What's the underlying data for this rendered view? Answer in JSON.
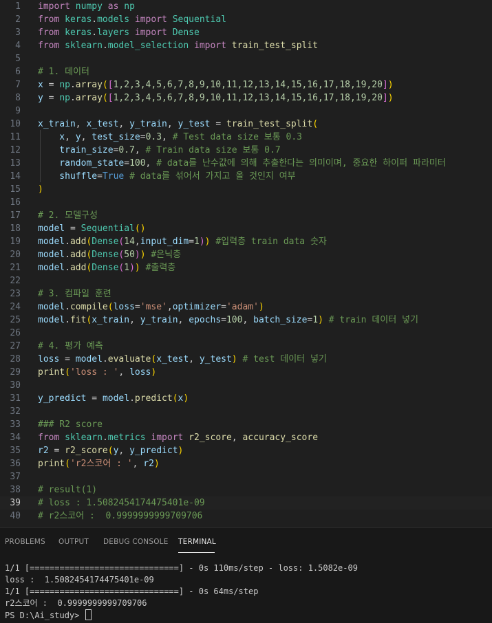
{
  "editor": {
    "lines": [
      {
        "n": "1",
        "tokens": [
          {
            "t": "import",
            "c": "keyword"
          },
          {
            "t": " numpy ",
            "c": "class"
          },
          {
            "t": "as",
            "c": "keyword"
          },
          {
            "t": " np",
            "c": "class"
          }
        ]
      },
      {
        "n": "2",
        "tokens": [
          {
            "t": "from",
            "c": "keyword"
          },
          {
            "t": " keras",
            "c": "class"
          },
          {
            "t": ".",
            "c": "plain"
          },
          {
            "t": "models",
            "c": "class"
          },
          {
            "t": " ",
            "c": "plain"
          },
          {
            "t": "import",
            "c": "keyword"
          },
          {
            "t": " Sequential",
            "c": "class"
          }
        ]
      },
      {
        "n": "3",
        "tokens": [
          {
            "t": "from",
            "c": "keyword"
          },
          {
            "t": " keras",
            "c": "class"
          },
          {
            "t": ".",
            "c": "plain"
          },
          {
            "t": "layers",
            "c": "class"
          },
          {
            "t": " ",
            "c": "plain"
          },
          {
            "t": "import",
            "c": "keyword"
          },
          {
            "t": " Dense",
            "c": "class"
          }
        ]
      },
      {
        "n": "4",
        "tokens": [
          {
            "t": "from",
            "c": "keyword"
          },
          {
            "t": " sklearn",
            "c": "class"
          },
          {
            "t": ".",
            "c": "plain"
          },
          {
            "t": "model_selection",
            "c": "class"
          },
          {
            "t": " ",
            "c": "plain"
          },
          {
            "t": "import",
            "c": "keyword"
          },
          {
            "t": " train_test_split",
            "c": "func"
          }
        ]
      },
      {
        "n": "5",
        "tokens": []
      },
      {
        "n": "6",
        "tokens": [
          {
            "t": "# 1. 데이터",
            "c": "comment"
          }
        ]
      },
      {
        "n": "7",
        "tokens": [
          {
            "t": "x",
            "c": "var"
          },
          {
            "t": " = ",
            "c": "plain"
          },
          {
            "t": "np",
            "c": "class"
          },
          {
            "t": ".",
            "c": "plain"
          },
          {
            "t": "array",
            "c": "func"
          },
          {
            "t": "(",
            "c": "bracket1"
          },
          {
            "t": "[",
            "c": "bracket2"
          },
          {
            "t": "1,2,3,4,5,6,7,8,9,10,11,12,13,14,15,16,17,18,19,20",
            "c": "num"
          },
          {
            "t": "]",
            "c": "bracket2"
          },
          {
            "t": ")",
            "c": "bracket1"
          }
        ]
      },
      {
        "n": "8",
        "tokens": [
          {
            "t": "y",
            "c": "var"
          },
          {
            "t": " = ",
            "c": "plain"
          },
          {
            "t": "np",
            "c": "class"
          },
          {
            "t": ".",
            "c": "plain"
          },
          {
            "t": "array",
            "c": "func"
          },
          {
            "t": "(",
            "c": "bracket1"
          },
          {
            "t": "[",
            "c": "bracket2"
          },
          {
            "t": "1,2,3,4,5,6,7,8,9,10,11,12,13,14,15,16,17,18,19,20",
            "c": "num"
          },
          {
            "t": "]",
            "c": "bracket2"
          },
          {
            "t": ")",
            "c": "bracket1"
          }
        ]
      },
      {
        "n": "9",
        "tokens": []
      },
      {
        "n": "10",
        "tokens": [
          {
            "t": "x_train",
            "c": "var"
          },
          {
            "t": ", ",
            "c": "plain"
          },
          {
            "t": "x_test",
            "c": "var"
          },
          {
            "t": ", ",
            "c": "plain"
          },
          {
            "t": "y_train",
            "c": "var"
          },
          {
            "t": ", ",
            "c": "plain"
          },
          {
            "t": "y_test",
            "c": "var"
          },
          {
            "t": " = ",
            "c": "plain"
          },
          {
            "t": "train_test_split",
            "c": "func"
          },
          {
            "t": "(",
            "c": "bracket1"
          }
        ]
      },
      {
        "n": "11",
        "tokens": [
          {
            "t": "    x",
            "c": "var"
          },
          {
            "t": ", ",
            "c": "plain"
          },
          {
            "t": "y",
            "c": "var"
          },
          {
            "t": ", ",
            "c": "plain"
          },
          {
            "t": "test_size",
            "c": "var"
          },
          {
            "t": "=",
            "c": "plain"
          },
          {
            "t": "0.3",
            "c": "num"
          },
          {
            "t": ", ",
            "c": "plain"
          },
          {
            "t": "# Test data size 보통 0.3",
            "c": "comment"
          }
        ]
      },
      {
        "n": "12",
        "tokens": [
          {
            "t": "    train_size",
            "c": "var"
          },
          {
            "t": "=",
            "c": "plain"
          },
          {
            "t": "0.7",
            "c": "num"
          },
          {
            "t": ", ",
            "c": "plain"
          },
          {
            "t": "# Train data size 보통 0.7",
            "c": "comment"
          }
        ]
      },
      {
        "n": "13",
        "tokens": [
          {
            "t": "    random_state",
            "c": "var"
          },
          {
            "t": "=",
            "c": "plain"
          },
          {
            "t": "100",
            "c": "num"
          },
          {
            "t": ", ",
            "c": "plain"
          },
          {
            "t": "# data를 난수값에 의해 추출한다는 의미이며, 중요한 하이퍼 파라미터",
            "c": "comment"
          }
        ]
      },
      {
        "n": "14",
        "tokens": [
          {
            "t": "    shuffle",
            "c": "var"
          },
          {
            "t": "=",
            "c": "plain"
          },
          {
            "t": "True",
            "c": "bool"
          },
          {
            "t": " ",
            "c": "plain"
          },
          {
            "t": "# data를 섞어서 가지고 올 것인지 여부",
            "c": "comment"
          }
        ]
      },
      {
        "n": "15",
        "tokens": [
          {
            "t": ")",
            "c": "bracket1"
          }
        ]
      },
      {
        "n": "16",
        "tokens": []
      },
      {
        "n": "17",
        "tokens": [
          {
            "t": "# 2. 모델구성",
            "c": "comment"
          }
        ]
      },
      {
        "n": "18",
        "tokens": [
          {
            "t": "model",
            "c": "var"
          },
          {
            "t": " = ",
            "c": "plain"
          },
          {
            "t": "Sequential",
            "c": "class"
          },
          {
            "t": "()",
            "c": "bracket1"
          }
        ]
      },
      {
        "n": "19",
        "tokens": [
          {
            "t": "model",
            "c": "var"
          },
          {
            "t": ".",
            "c": "plain"
          },
          {
            "t": "add",
            "c": "func"
          },
          {
            "t": "(",
            "c": "bracket1"
          },
          {
            "t": "Dense",
            "c": "class"
          },
          {
            "t": "(",
            "c": "bracket2"
          },
          {
            "t": "14",
            "c": "num"
          },
          {
            "t": ",",
            "c": "plain"
          },
          {
            "t": "input_dim",
            "c": "var"
          },
          {
            "t": "=",
            "c": "plain"
          },
          {
            "t": "1",
            "c": "num"
          },
          {
            "t": ")",
            "c": "bracket2"
          },
          {
            "t": ")",
            "c": "bracket1"
          },
          {
            "t": " ",
            "c": "plain"
          },
          {
            "t": "#입력층 train data 숫자",
            "c": "comment"
          }
        ]
      },
      {
        "n": "20",
        "tokens": [
          {
            "t": "model",
            "c": "var"
          },
          {
            "t": ".",
            "c": "plain"
          },
          {
            "t": "add",
            "c": "func"
          },
          {
            "t": "(",
            "c": "bracket1"
          },
          {
            "t": "Dense",
            "c": "class"
          },
          {
            "t": "(",
            "c": "bracket2"
          },
          {
            "t": "50",
            "c": "num"
          },
          {
            "t": ")",
            "c": "bracket2"
          },
          {
            "t": ")",
            "c": "bracket1"
          },
          {
            "t": " ",
            "c": "plain"
          },
          {
            "t": "#은닉층",
            "c": "comment"
          }
        ]
      },
      {
        "n": "21",
        "tokens": [
          {
            "t": "model",
            "c": "var"
          },
          {
            "t": ".",
            "c": "plain"
          },
          {
            "t": "add",
            "c": "func"
          },
          {
            "t": "(",
            "c": "bracket1"
          },
          {
            "t": "Dense",
            "c": "class"
          },
          {
            "t": "(",
            "c": "bracket2"
          },
          {
            "t": "1",
            "c": "num"
          },
          {
            "t": ")",
            "c": "bracket2"
          },
          {
            "t": ")",
            "c": "bracket1"
          },
          {
            "t": " ",
            "c": "plain"
          },
          {
            "t": "#출력층",
            "c": "comment"
          }
        ]
      },
      {
        "n": "22",
        "tokens": []
      },
      {
        "n": "23",
        "tokens": [
          {
            "t": "# 3. 컴파일 훈련",
            "c": "comment"
          }
        ]
      },
      {
        "n": "24",
        "tokens": [
          {
            "t": "model",
            "c": "var"
          },
          {
            "t": ".",
            "c": "plain"
          },
          {
            "t": "compile",
            "c": "func"
          },
          {
            "t": "(",
            "c": "bracket1"
          },
          {
            "t": "loss",
            "c": "var"
          },
          {
            "t": "=",
            "c": "plain"
          },
          {
            "t": "'mse'",
            "c": "str"
          },
          {
            "t": ",",
            "c": "plain"
          },
          {
            "t": "optimizer",
            "c": "var"
          },
          {
            "t": "=",
            "c": "plain"
          },
          {
            "t": "'adam'",
            "c": "str"
          },
          {
            "t": ")",
            "c": "bracket1"
          }
        ]
      },
      {
        "n": "25",
        "tokens": [
          {
            "t": "model",
            "c": "var"
          },
          {
            "t": ".",
            "c": "plain"
          },
          {
            "t": "fit",
            "c": "func"
          },
          {
            "t": "(",
            "c": "bracket1"
          },
          {
            "t": "x_train",
            "c": "var"
          },
          {
            "t": ", ",
            "c": "plain"
          },
          {
            "t": "y_train",
            "c": "var"
          },
          {
            "t": ", ",
            "c": "plain"
          },
          {
            "t": "epochs",
            "c": "var"
          },
          {
            "t": "=",
            "c": "plain"
          },
          {
            "t": "100",
            "c": "num"
          },
          {
            "t": ", ",
            "c": "plain"
          },
          {
            "t": "batch_size",
            "c": "var"
          },
          {
            "t": "=",
            "c": "plain"
          },
          {
            "t": "1",
            "c": "num"
          },
          {
            "t": ")",
            "c": "bracket1"
          },
          {
            "t": " ",
            "c": "plain"
          },
          {
            "t": "# train 데이터 넣기",
            "c": "comment"
          }
        ]
      },
      {
        "n": "26",
        "tokens": []
      },
      {
        "n": "27",
        "tokens": [
          {
            "t": "# 4. 평가 예측",
            "c": "comment"
          }
        ]
      },
      {
        "n": "28",
        "tokens": [
          {
            "t": "loss",
            "c": "var"
          },
          {
            "t": " = ",
            "c": "plain"
          },
          {
            "t": "model",
            "c": "var"
          },
          {
            "t": ".",
            "c": "plain"
          },
          {
            "t": "evaluate",
            "c": "func"
          },
          {
            "t": "(",
            "c": "bracket1"
          },
          {
            "t": "x_test",
            "c": "var"
          },
          {
            "t": ", ",
            "c": "plain"
          },
          {
            "t": "y_test",
            "c": "var"
          },
          {
            "t": ")",
            "c": "bracket1"
          },
          {
            "t": " ",
            "c": "plain"
          },
          {
            "t": "# test 데이터 넣기",
            "c": "comment"
          }
        ]
      },
      {
        "n": "29",
        "tokens": [
          {
            "t": "print",
            "c": "func"
          },
          {
            "t": "(",
            "c": "bracket1"
          },
          {
            "t": "'loss : '",
            "c": "str"
          },
          {
            "t": ", ",
            "c": "plain"
          },
          {
            "t": "loss",
            "c": "var"
          },
          {
            "t": ")",
            "c": "bracket1"
          }
        ]
      },
      {
        "n": "30",
        "tokens": []
      },
      {
        "n": "31",
        "tokens": [
          {
            "t": "y_predict",
            "c": "var"
          },
          {
            "t": " = ",
            "c": "plain"
          },
          {
            "t": "model",
            "c": "var"
          },
          {
            "t": ".",
            "c": "plain"
          },
          {
            "t": "predict",
            "c": "func"
          },
          {
            "t": "(",
            "c": "bracket1"
          },
          {
            "t": "x",
            "c": "var"
          },
          {
            "t": ")",
            "c": "bracket1"
          }
        ]
      },
      {
        "n": "32",
        "tokens": []
      },
      {
        "n": "33",
        "tokens": [
          {
            "t": "### R2 score",
            "c": "comment"
          }
        ]
      },
      {
        "n": "34",
        "tokens": [
          {
            "t": "from",
            "c": "keyword"
          },
          {
            "t": " sklearn",
            "c": "class"
          },
          {
            "t": ".",
            "c": "plain"
          },
          {
            "t": "metrics",
            "c": "class"
          },
          {
            "t": " ",
            "c": "plain"
          },
          {
            "t": "import",
            "c": "keyword"
          },
          {
            "t": " r2_score",
            "c": "func"
          },
          {
            "t": ", ",
            "c": "plain"
          },
          {
            "t": "accuracy_score",
            "c": "func"
          }
        ]
      },
      {
        "n": "35",
        "tokens": [
          {
            "t": "r2",
            "c": "var"
          },
          {
            "t": " = ",
            "c": "plain"
          },
          {
            "t": "r2_score",
            "c": "func"
          },
          {
            "t": "(",
            "c": "bracket1"
          },
          {
            "t": "y",
            "c": "var"
          },
          {
            "t": ", ",
            "c": "plain"
          },
          {
            "t": "y_predict",
            "c": "var"
          },
          {
            "t": ")",
            "c": "bracket1"
          }
        ]
      },
      {
        "n": "36",
        "tokens": [
          {
            "t": "print",
            "c": "func"
          },
          {
            "t": "(",
            "c": "bracket1"
          },
          {
            "t": "'r2스코어 : '",
            "c": "str"
          },
          {
            "t": ", ",
            "c": "plain"
          },
          {
            "t": "r2",
            "c": "var"
          },
          {
            "t": ")",
            "c": "bracket1"
          }
        ]
      },
      {
        "n": "37",
        "tokens": []
      },
      {
        "n": "38",
        "tokens": [
          {
            "t": "# result(1)",
            "c": "comment"
          }
        ]
      },
      {
        "n": "39",
        "tokens": [
          {
            "t": "# loss : 1.5082454174475401e-09",
            "c": "comment"
          }
        ],
        "active": true
      },
      {
        "n": "40",
        "tokens": [
          {
            "t": "# r2스코어 :  0.9999999999709706",
            "c": "comment"
          }
        ]
      }
    ]
  },
  "panel": {
    "tabs": [
      {
        "label": "PROBLEMS",
        "name": "tab-problems",
        "active": false
      },
      {
        "label": "OUTPUT",
        "name": "tab-output",
        "active": false
      },
      {
        "label": "DEBUG CONSOLE",
        "name": "tab-debug-console",
        "active": false
      },
      {
        "label": "TERMINAL",
        "name": "tab-terminal",
        "active": true
      }
    ],
    "terminal_lines": [
      "1/1 [==============================] - 0s 110ms/step - loss: 1.5082e-09",
      "loss :  1.5082454174475401e-09",
      "1/1 [==============================] - 0s 64ms/step",
      "r2스코어 :  0.9999999999709706",
      "PS D:\\Ai_study> "
    ]
  }
}
